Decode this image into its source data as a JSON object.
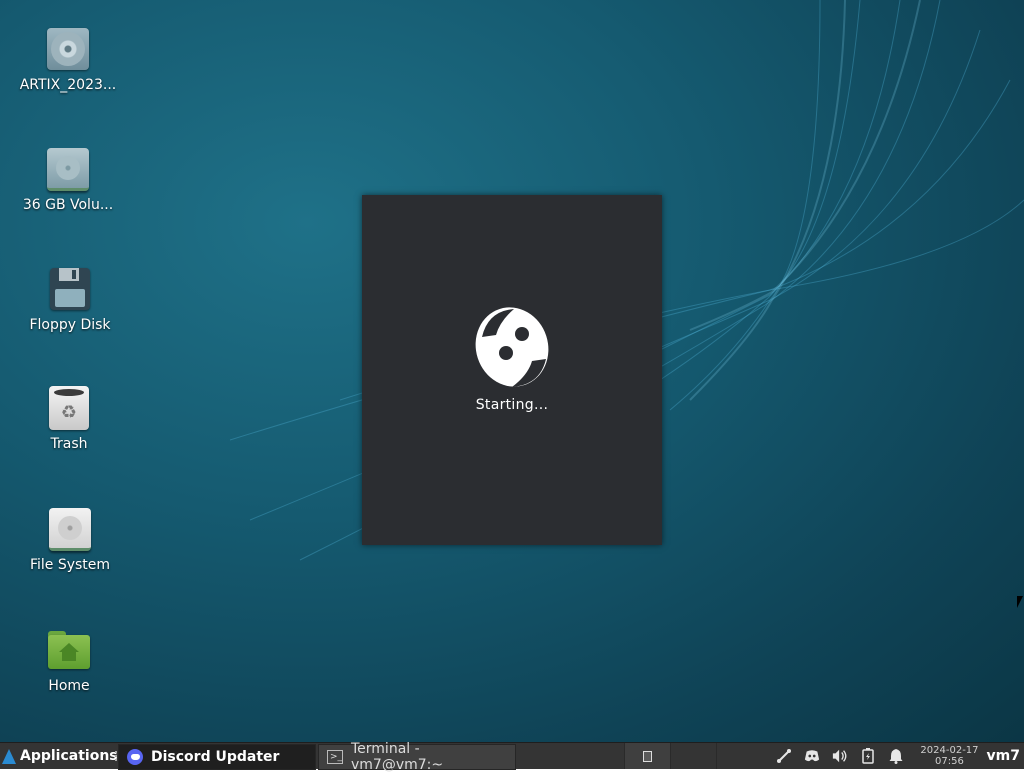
{
  "desktop": {
    "icons": [
      {
        "label": "ARTIX_2023...",
        "icon": "disc-icon"
      },
      {
        "label": "36 GB Volu...",
        "icon": "drive-icon"
      },
      {
        "label": "Floppy Disk",
        "icon": "floppy-icon"
      },
      {
        "label": "Trash",
        "icon": "trash-icon"
      },
      {
        "label": "File System",
        "icon": "filesystem-icon"
      },
      {
        "label": "Home",
        "icon": "home-folder-icon"
      }
    ]
  },
  "updater": {
    "status": "Starting...",
    "icon": "discord-logo-icon",
    "background": "#2b2d31"
  },
  "taskbar": {
    "apps_label": "Applications",
    "tasks": [
      {
        "label": "Discord Updater",
        "icon": "discord-icon",
        "active": true
      },
      {
        "label": "Terminal - vm7@vm7:~",
        "icon": "terminal-icon",
        "active": false
      }
    ],
    "tray_icons": [
      "network-icon",
      "discord-tray-icon",
      "volume-icon",
      "battery-icon",
      "notification-bell-icon"
    ],
    "clock": {
      "date": "2024-02-17",
      "time": "07:56"
    },
    "user": "vm7"
  },
  "colors": {
    "desktop_base": "#155a70",
    "taskbar": "#343434",
    "accent": "#2a8bd2",
    "discord": "#5865f2"
  }
}
